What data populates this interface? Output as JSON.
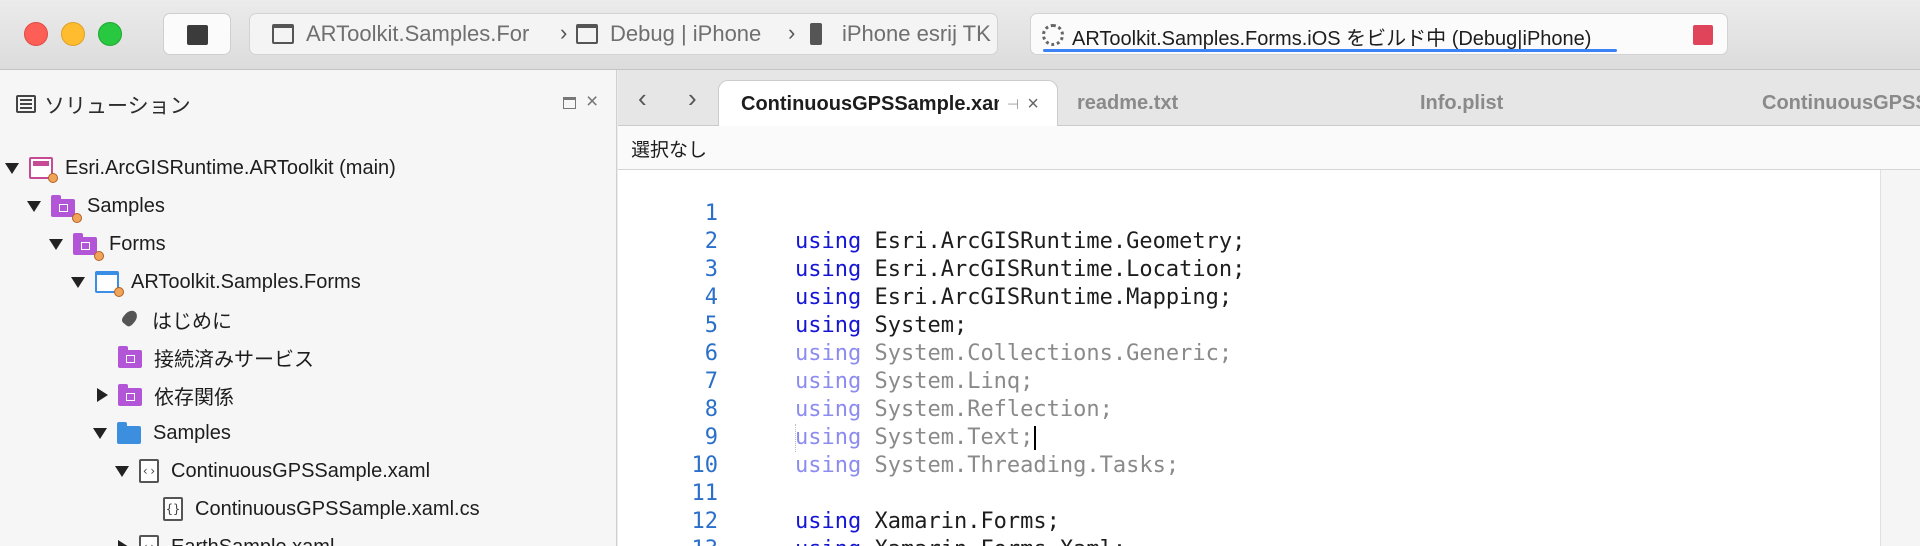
{
  "toolbar": {
    "config_project": "ARToolkit.Samples.Forms.iOS",
    "config_build": "Debug | iPhone",
    "config_device": "iPhone esrij TK",
    "status_text": "ARToolkit.Samples.Forms.iOS をビルド中 (Debug|iPhone)"
  },
  "solution": {
    "title": "ソリューション",
    "items": [
      {
        "label": "Esri.ArcGISRuntime.ARToolkit (main)"
      },
      {
        "label": "Samples"
      },
      {
        "label": "Forms"
      },
      {
        "label": "ARToolkit.Samples.Forms"
      },
      {
        "label": "はじめに"
      },
      {
        "label": "接続済みサービス"
      },
      {
        "label": "依存関係"
      },
      {
        "label": "Samples"
      },
      {
        "label": "ContinuousGPSSample.xaml"
      },
      {
        "label": "ContinuousGPSSample.xaml.cs"
      },
      {
        "label": "EarthSample.xaml"
      }
    ]
  },
  "editor": {
    "tabs": [
      {
        "label": "ContinuousGPSSample.xaml.cs"
      },
      {
        "label": "readme.txt"
      },
      {
        "label": "Info.plist"
      },
      {
        "label": "ContinuousGPSSample.xaml"
      }
    ],
    "breadcrumb": "選択なし",
    "lines": [
      {
        "n": "1",
        "kw": "using",
        "id": " Esri.ArcGISRuntime.Geometry;"
      },
      {
        "n": "2",
        "kw": "using",
        "id": " Esri.ArcGISRuntime.Location;"
      },
      {
        "n": "3",
        "kw": "using",
        "id": " Esri.ArcGISRuntime.Mapping;"
      },
      {
        "n": "4",
        "kw": "using",
        "id": " System;"
      },
      {
        "n": "5",
        "kw": "using",
        "id": " System.Collections.Generic;"
      },
      {
        "n": "6",
        "kw": "using",
        "id": " System.Linq;"
      },
      {
        "n": "7",
        "kw": "using",
        "id": " System.Reflection;"
      },
      {
        "n": "8",
        "kw": "using",
        "id": " System.Text;"
      },
      {
        "n": "9",
        "kw": "using",
        "id": " System.Threading.Tasks;"
      },
      {
        "n": "10",
        "kw": "",
        "id": ""
      },
      {
        "n": "11",
        "kw": "using",
        "id": " Xamarin.Forms;"
      },
      {
        "n": "12",
        "kw": "using",
        "id": " Xamarin.Forms.Xaml;"
      },
      {
        "n": "13",
        "kw": "",
        "id": ""
      }
    ]
  },
  "colors": {
    "keyword": "#1515d6",
    "line_number": "#2a6fc9",
    "progress": "#3b82f6",
    "stop_red": "#e0445a"
  }
}
